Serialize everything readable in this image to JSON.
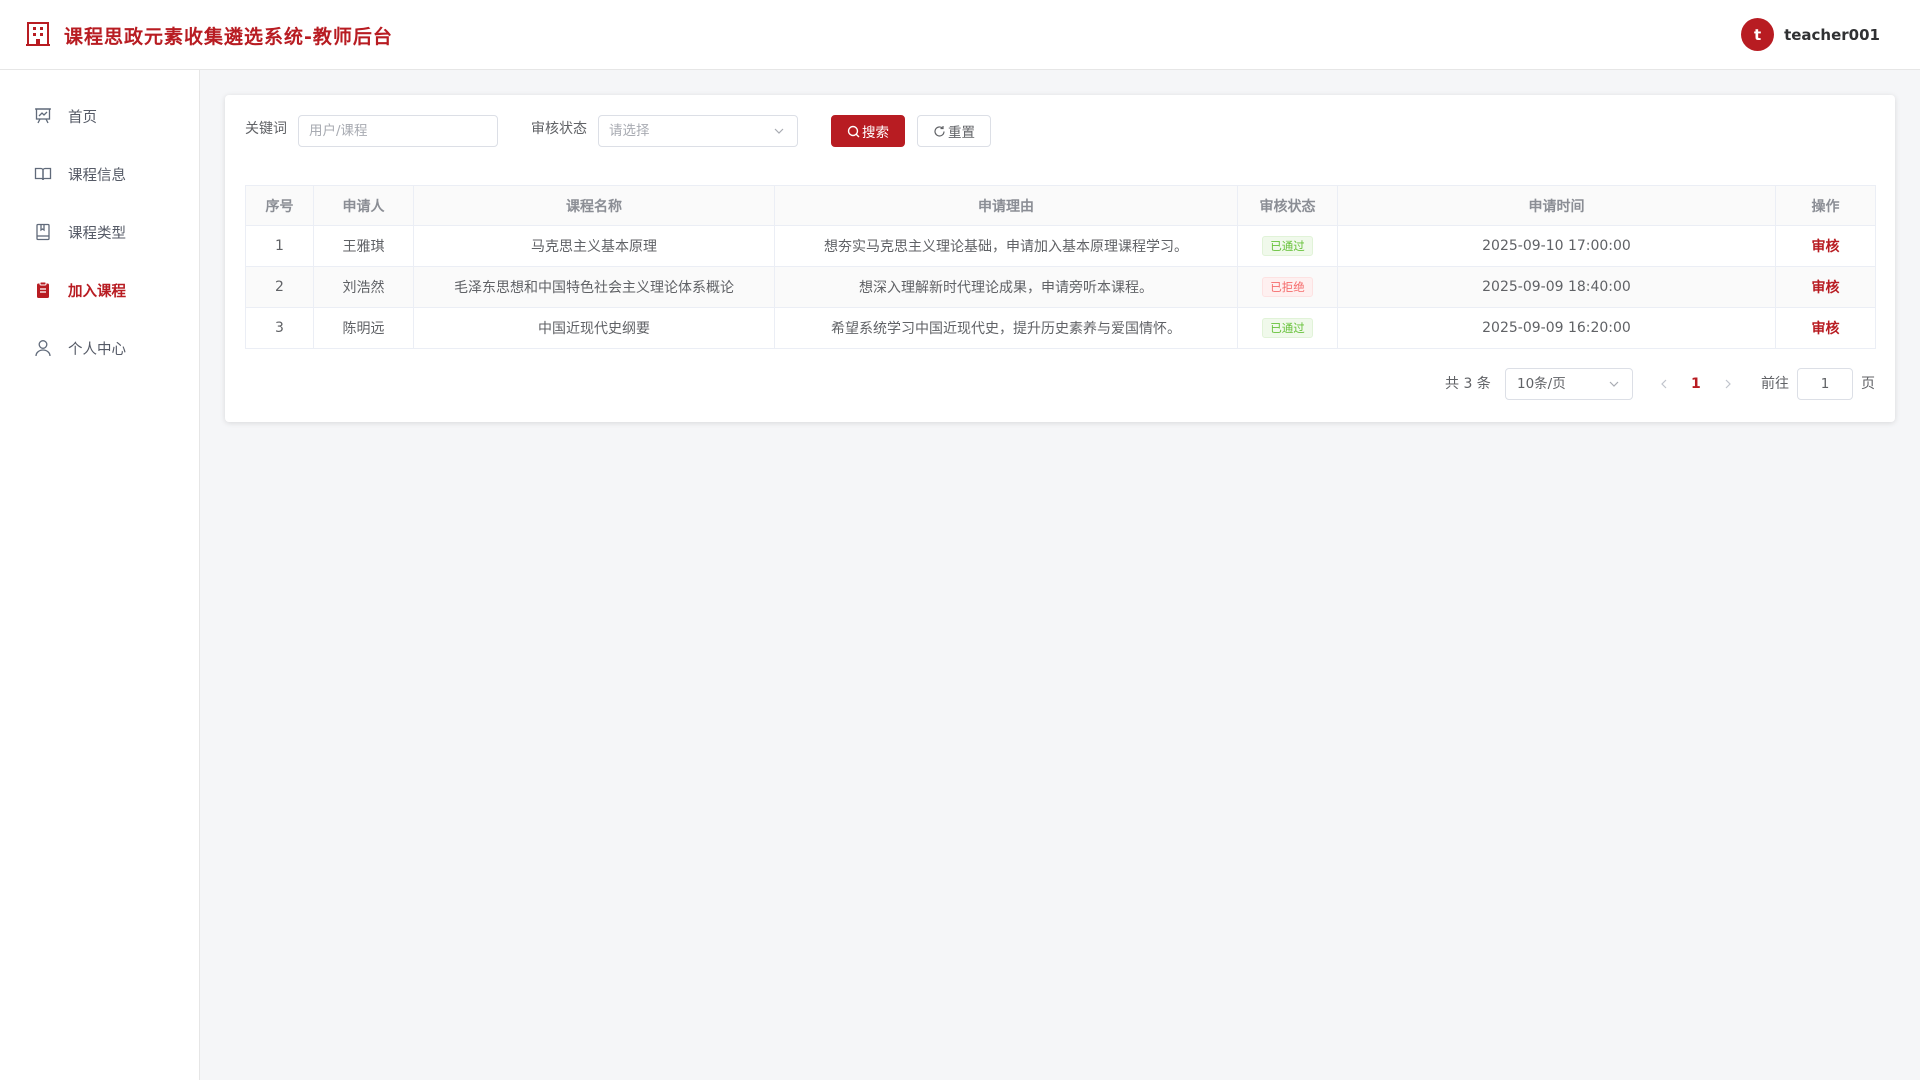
{
  "header": {
    "title": "课程思政元素收集遴选系统-教师后台",
    "avatar_letter": "t",
    "username": "teacher001"
  },
  "sidebar": {
    "items": [
      {
        "label": "首页",
        "icon": "presentation-icon"
      },
      {
        "label": "课程信息",
        "icon": "book-open-icon"
      },
      {
        "label": "课程类型",
        "icon": "notebook-icon"
      },
      {
        "label": "加入课程",
        "icon": "clipboard-icon",
        "active": true
      },
      {
        "label": "个人中心",
        "icon": "user-icon"
      }
    ]
  },
  "filters": {
    "keyword_label": "关键词",
    "keyword_placeholder": "用户/课程",
    "status_label": "审核状态",
    "status_placeholder": "请选择",
    "search_label": "搜索",
    "reset_label": "重置"
  },
  "table": {
    "columns": [
      "序号",
      "申请人",
      "课程名称",
      "申请理由",
      "审核状态",
      "申请时间",
      "操作"
    ],
    "rows": [
      {
        "index": "1",
        "applicant": "王雅琪",
        "course": "马克思主义基本原理",
        "reason": "想夯实马克思主义理论基础，申请加入基本原理课程学习。",
        "status": "已通过",
        "status_type": "success",
        "time": "2025-09-10 17:00:00",
        "action": "审核"
      },
      {
        "index": "2",
        "applicant": "刘浩然",
        "course": "毛泽东思想和中国特色社会主义理论体系概论",
        "reason": "想深入理解新时代理论成果，申请旁听本课程。",
        "status": "已拒绝",
        "status_type": "danger",
        "time": "2025-09-09 18:40:00",
        "action": "审核"
      },
      {
        "index": "3",
        "applicant": "陈明远",
        "course": "中国近现代史纲要",
        "reason": "希望系统学习中国近现代史，提升历史素养与爱国情怀。",
        "status": "已通过",
        "status_type": "success",
        "time": "2025-09-09 16:20:00",
        "action": "审核"
      }
    ]
  },
  "pagination": {
    "total_text": "共 3 条",
    "page_size": "10条/页",
    "current_page": "1",
    "goto_label": "前往",
    "goto_value": "1",
    "page_suffix": "页"
  },
  "colors": {
    "brand": "#b81c22",
    "success": "#67c23a",
    "danger": "#f56c6c"
  }
}
